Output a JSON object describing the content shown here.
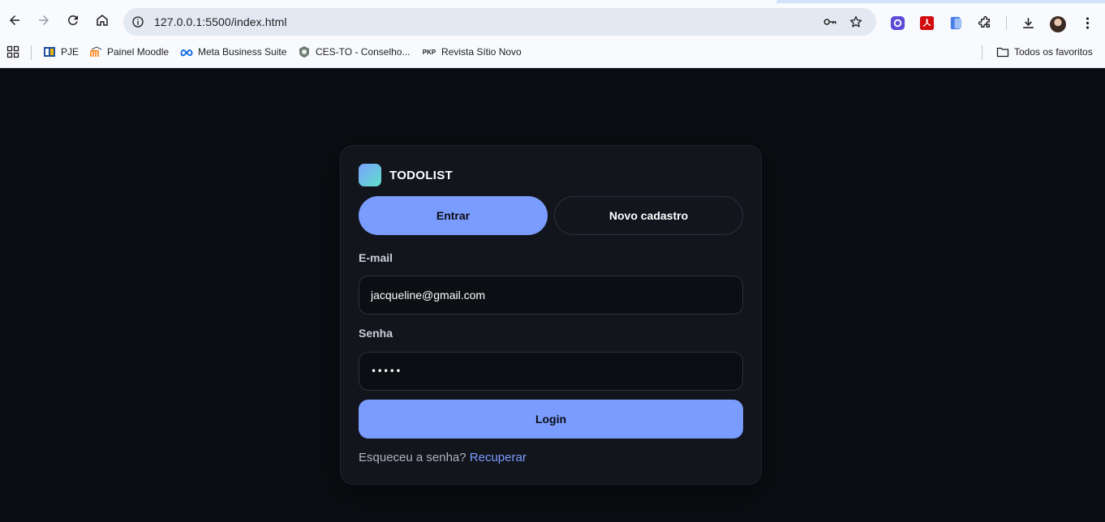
{
  "browser": {
    "url": "127.0.0.1:5500/index.html",
    "bookmarks": [
      {
        "label": "PJE",
        "icon": "pje-icon"
      },
      {
        "label": "Painel Moodle",
        "icon": "moodle-icon"
      },
      {
        "label": "Meta Business Suite",
        "icon": "meta-icon"
      },
      {
        "label": "CES-TO - Conselho...",
        "icon": "ces-to-icon"
      },
      {
        "label": "Revista Sítio Novo",
        "icon": "pkp-icon"
      }
    ],
    "pkp_icon_text": "PKP",
    "all_bookmarks_label": "Todos os favoritos"
  },
  "app": {
    "brand": "TODOLIST",
    "tabs": {
      "login": "Entrar",
      "signup": "Novo cadastro"
    },
    "active_tab": "login",
    "email": {
      "label": "E-mail",
      "value": "jacqueline@gmail.com"
    },
    "password": {
      "label": "Senha",
      "masked_value": "•••••"
    },
    "login_button": "Login",
    "forgot": {
      "text": "Esqueceu a senha?",
      "link": "Recuperar"
    },
    "colors": {
      "accent": "#7b9cff",
      "background": "#0b0d12",
      "card": "#12151c"
    }
  }
}
